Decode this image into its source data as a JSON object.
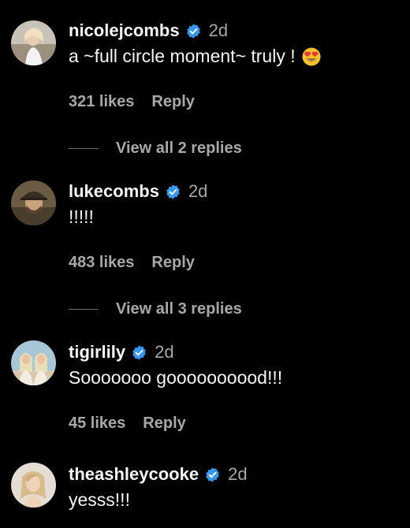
{
  "colors": {
    "background": "#000000",
    "primary_text": "#f5f5f5",
    "secondary_text": "#a8a8a8",
    "verified_badge": "#3897f0"
  },
  "comments": [
    {
      "username": "nicolejcombs",
      "verified": true,
      "time": "2d",
      "text": "a ~full circle moment~ truly !",
      "emoji": "heart-eyes-emoji",
      "likes": "321 likes",
      "reply_label": "Reply",
      "view_replies": "View all 2 replies"
    },
    {
      "username": "lukecombs",
      "verified": true,
      "time": "2d",
      "text": "!!!!!",
      "likes": "483 likes",
      "reply_label": "Reply",
      "view_replies": "View all 3 replies"
    },
    {
      "username": "tigirlily",
      "verified": true,
      "time": "2d",
      "text": "Sooooooo goooooooood!!!",
      "likes": "45 likes",
      "reply_label": "Reply"
    },
    {
      "username": "theashleycooke",
      "verified": true,
      "time": "2d",
      "text": "yesss!!!"
    }
  ]
}
